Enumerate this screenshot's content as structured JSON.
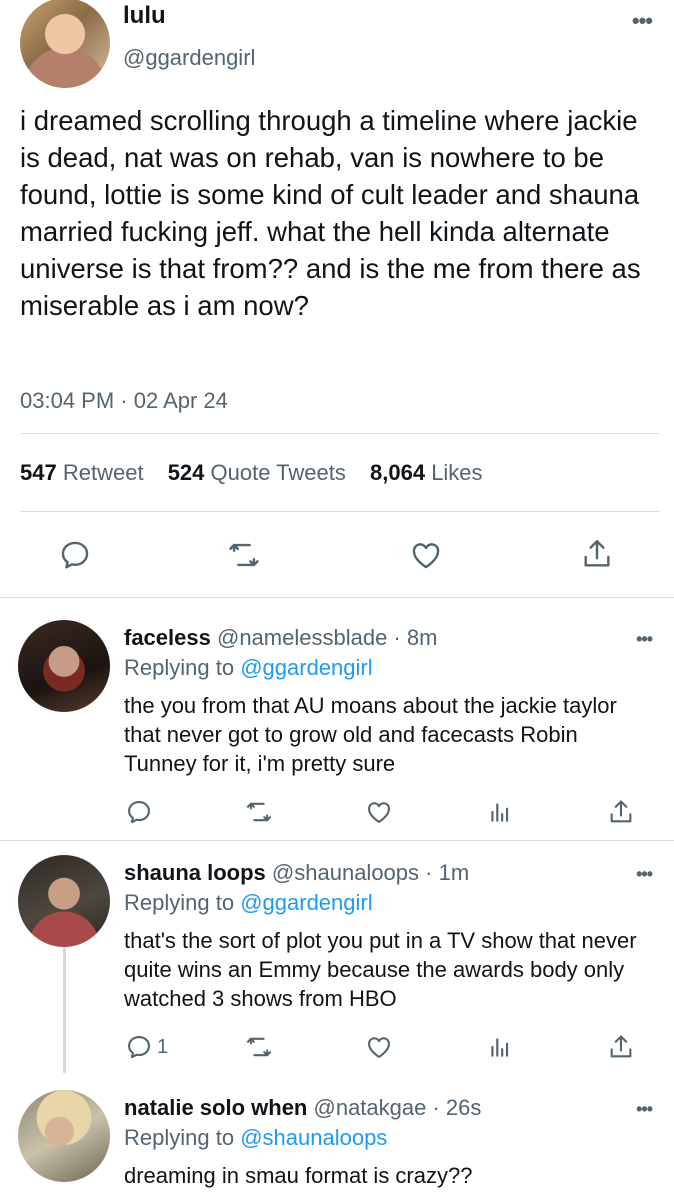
{
  "main_tweet": {
    "name": "lulu",
    "handle": "@ggardengirl",
    "text": "i dreamed scrolling through a timeline where jackie is dead, nat was on rehab, van is nowhere to be found, lottie is some kind of cult leader and shauna married fucking jeff. what the hell kinda alternate universe is that from?? and is the me from there as miserable as i am now?",
    "timestamp": "03:04 PM · 02 Apr 24",
    "stats": [
      {
        "value": "547",
        "label": "Retweet"
      },
      {
        "value": "524",
        "label": "Quote Tweets"
      },
      {
        "value": "8,064",
        "label": "Likes"
      }
    ],
    "actions": [
      "reply-icon",
      "retweet-icon",
      "like-icon",
      "share-icon"
    ]
  },
  "replies": [
    {
      "name": "faceless",
      "handle": "@namelessblade",
      "time": "8m",
      "replying_label": "Replying to",
      "replying_to": "@ggardengirl",
      "text": "the you from that AU moans about the jackie taylor that never got to grow old and facecasts Robin Tunney for it, i'm pretty sure",
      "reply_count": ""
    },
    {
      "name": "shauna loops",
      "handle": "@shaunaloops",
      "time": "1m",
      "replying_label": "Replying to",
      "replying_to": "@ggardengirl",
      "text": "that's the sort of plot you put in a TV show that never quite wins an Emmy because the awards body only watched 3 shows from HBO",
      "reply_count": "1"
    },
    {
      "name": "natalie solo when",
      "handle": "@natakgae",
      "time": "26s",
      "replying_label": "Replying to",
      "replying_to": "@shaunaloops",
      "text": "dreaming in smau format is crazy??"
    }
  ],
  "separator": " · ",
  "colors": {
    "link": "#1d9bf0",
    "muted": "#536471",
    "text": "#0f1419",
    "divider": "#d9dee3"
  }
}
